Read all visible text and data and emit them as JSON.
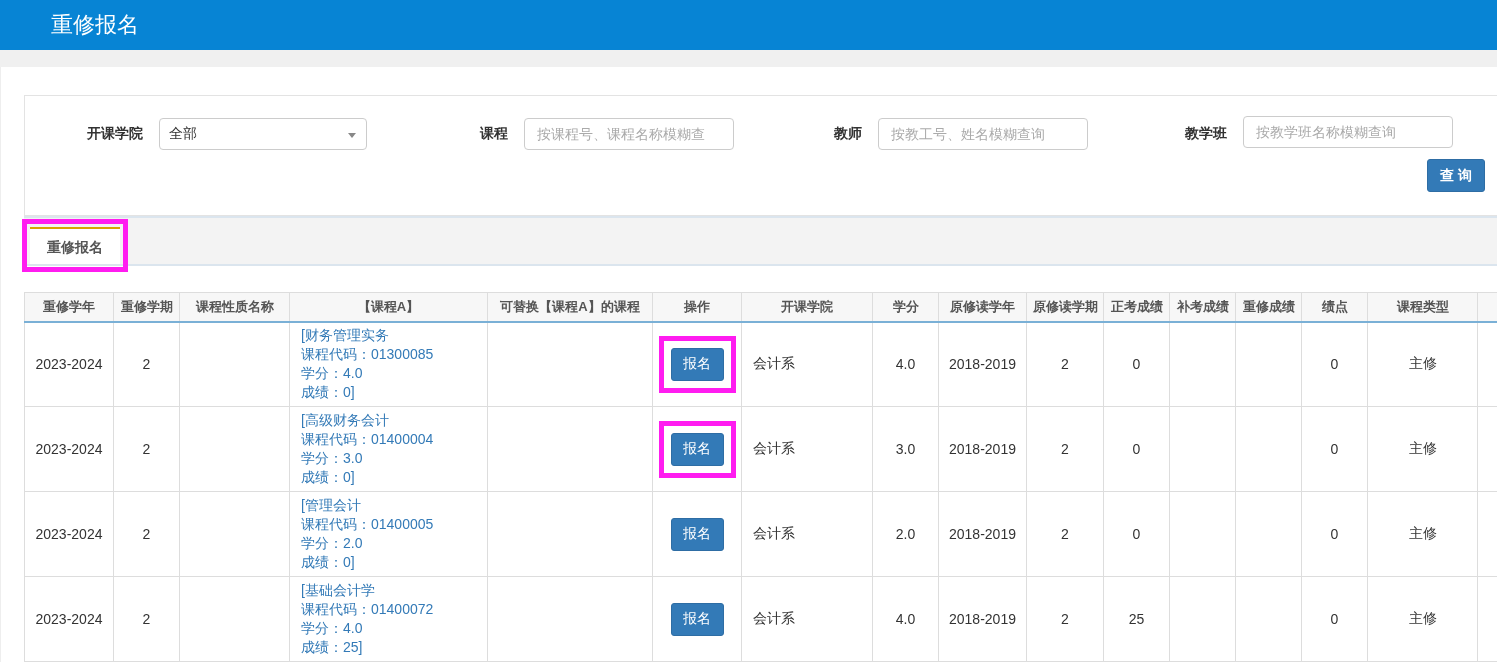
{
  "header": {
    "title": "重修报名"
  },
  "filters": [
    {
      "kind": "select",
      "label": "开课学院",
      "value": "全部"
    },
    {
      "kind": "input",
      "label": "课程",
      "placeholder": "按课程号、课程名称模糊查"
    },
    {
      "kind": "input",
      "label": "教师",
      "placeholder": "按教工号、姓名模糊查询"
    },
    {
      "kind": "input",
      "label": "教学班",
      "placeholder": "按教学班名称模糊查询"
    }
  ],
  "query_button": "查 询",
  "tabs": [
    {
      "label": "重修报名",
      "selected": true,
      "highlighted": true
    }
  ],
  "table": {
    "columns": [
      "重修学年",
      "重修学期",
      "课程性质名称",
      "【课程A】",
      "可替换【课程A】的课程",
      "操作",
      "开课学院",
      "学分",
      "原修读学年",
      "原修读学期",
      "正考成绩",
      "补考成绩",
      "重修成绩",
      "绩点",
      "课程类型"
    ],
    "rows": [
      {
        "year": "2023-2024",
        "term": "2",
        "nature": "",
        "course_a": [
          "[财务管理实务",
          "课程代码：01300085",
          "学分：4.0",
          "成绩：0]"
        ],
        "replace": "",
        "action": "报名",
        "action_highlighted": true,
        "college": "会计系",
        "credit": "4.0",
        "orig_year": "2018-2019",
        "orig_term": "2",
        "exam": "0",
        "makeup": "",
        "retake": "",
        "gpa": "0",
        "type": "主修"
      },
      {
        "year": "2023-2024",
        "term": "2",
        "nature": "",
        "course_a": [
          "[高级财务会计",
          "课程代码：01400004",
          "学分：3.0",
          "成绩：0]"
        ],
        "replace": "",
        "action": "报名",
        "action_highlighted": true,
        "college": "会计系",
        "credit": "3.0",
        "orig_year": "2018-2019",
        "orig_term": "2",
        "exam": "0",
        "makeup": "",
        "retake": "",
        "gpa": "0",
        "type": "主修"
      },
      {
        "year": "2023-2024",
        "term": "2",
        "nature": "",
        "course_a": [
          "[管理会计",
          "课程代码：01400005",
          "学分：2.0",
          "成绩：0]"
        ],
        "replace": "",
        "action": "报名",
        "action_highlighted": false,
        "college": "会计系",
        "credit": "2.0",
        "orig_year": "2018-2019",
        "orig_term": "2",
        "exam": "0",
        "makeup": "",
        "retake": "",
        "gpa": "0",
        "type": "主修"
      },
      {
        "year": "2023-2024",
        "term": "2",
        "nature": "",
        "course_a": [
          "[基础会计学",
          "课程代码：01400072",
          "学分：4.0",
          "成绩：25]"
        ],
        "replace": "",
        "action": "报名",
        "action_highlighted": false,
        "college": "会计系",
        "credit": "4.0",
        "orig_year": "2018-2019",
        "orig_term": "2",
        "exam": "25",
        "makeup": "",
        "retake": "",
        "gpa": "0",
        "type": "主修"
      }
    ]
  }
}
